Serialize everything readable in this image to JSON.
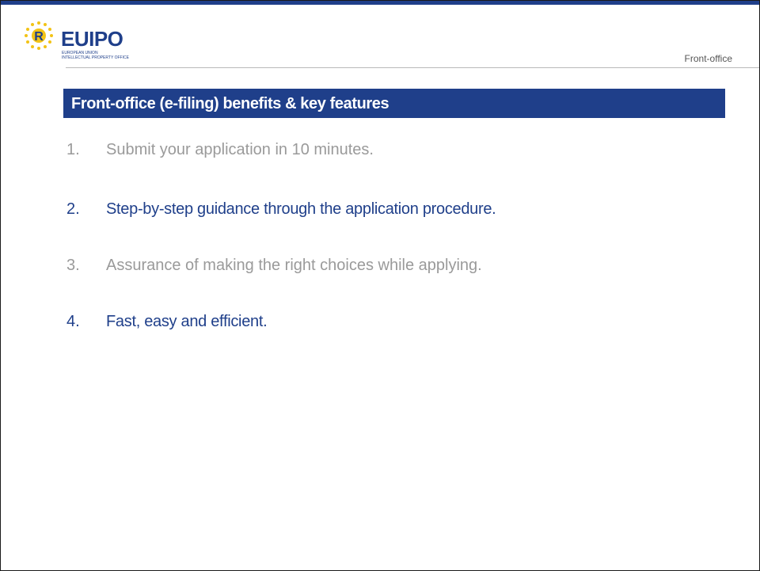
{
  "brand": {
    "wordmark": "EUIPO",
    "subtitle_line1": "EUROPEAN UNION",
    "subtitle_line2": "INTELLECTUAL PROPERTY OFFICE",
    "emblem_icon": "eu-stars-r-emblem-icon",
    "primary_color": "#1f3f8a",
    "star_color": "#f2c316"
  },
  "header": {
    "section_label": "Front-office"
  },
  "slide": {
    "title": "Front-office (e-filing) benefits & key features",
    "items": [
      {
        "number": "1.",
        "text": "Submit your application in 10 minutes."
      },
      {
        "number": "2.",
        "text": "Step-by-step guidance through the application procedure."
      },
      {
        "number": "3.",
        "text": "Assurance of making the right choices while applying."
      },
      {
        "number": "4.",
        "text": "Fast, easy and efficient."
      }
    ]
  }
}
